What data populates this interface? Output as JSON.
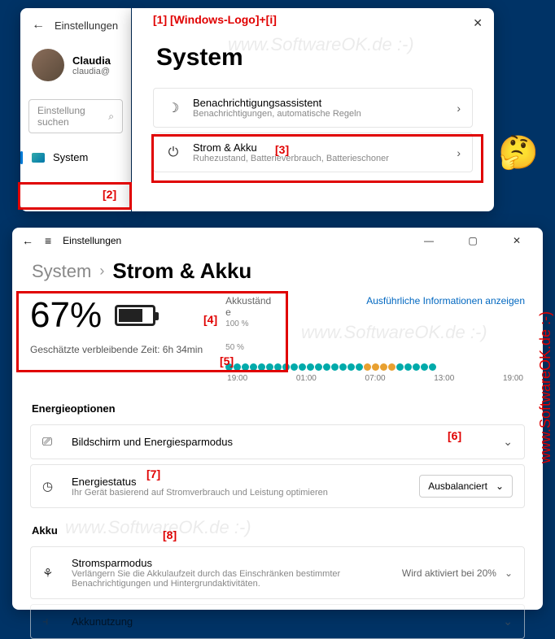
{
  "annotations": {
    "shortcut": "[1] [Windows-Logo]+[i]",
    "n2": "[2]",
    "n3": "[3]",
    "n4": "[4]",
    "n5": "[5]",
    "n6": "[6]",
    "n7": "[7]",
    "n8": "[8]"
  },
  "win1": {
    "back": "←",
    "title": "Einstellungen",
    "profile_name": "Claudia",
    "profile_email": "claudia@",
    "search_placeholder": "Einstellung suchen",
    "nav_system": "System"
  },
  "win1b": {
    "title": "System",
    "items": [
      {
        "icon": "☽",
        "title": "Benachrichtigungsassistent",
        "sub": "Benachrichtigungen, automatische Regeln"
      },
      {
        "icon": "⏻",
        "title": "Strom & Akku",
        "sub": "Ruhezustand, Batterieverbrauch, Batterieschoner"
      }
    ]
  },
  "win2": {
    "header_title": "Einstellungen",
    "crumb1": "System",
    "crumb2": "Strom & Akku",
    "akkustand_label": "Akkuständ\ne",
    "detail_link": "Ausführliche Informationen anzeigen",
    "y100": "100 %",
    "y50": "50 %",
    "percent": "67%",
    "estimate_label": "Geschätzte verbleibende Zeit: ",
    "estimate_value": "6h 34min",
    "times": [
      "19:00",
      "01:00",
      "07:00",
      "13:00",
      "19:00"
    ],
    "section_energy": "Energieoptionen",
    "screen_item": "Bildschirm und Energiesparmodus",
    "energy_status_title": "Energiestatus",
    "energy_status_sub": "Ihr Gerät basierend auf Stromverbrauch und Leistung optimieren",
    "energy_status_value": "Ausbalanciert",
    "section_akku": "Akku",
    "sparmodus_title": "Stromsparmodus",
    "sparmodus_sub": "Verlängern Sie die Akkulaufzeit durch das Einschränken bestimmter Benachrichtigungen und Hintergrundaktivitäten.",
    "sparmodus_value": "Wird aktiviert bei 20%",
    "akkunutzung": "Akkunutzung"
  },
  "chart_data": {
    "type": "bar",
    "title": "Akkustände",
    "ylabel": "%",
    "ylim": [
      0,
      100
    ],
    "x_labels": [
      "19:00",
      "01:00",
      "07:00",
      "13:00",
      "19:00"
    ],
    "series": [
      {
        "name": "charge",
        "color": "teal",
        "count_approx": 20
      },
      {
        "name": "discharge",
        "color": "amber",
        "count_approx": 4
      }
    ],
    "note": "Dot strip showing hourly battery states; exact per-hour values not labeled."
  },
  "watermark": "www.SoftwareOK.de :-)"
}
